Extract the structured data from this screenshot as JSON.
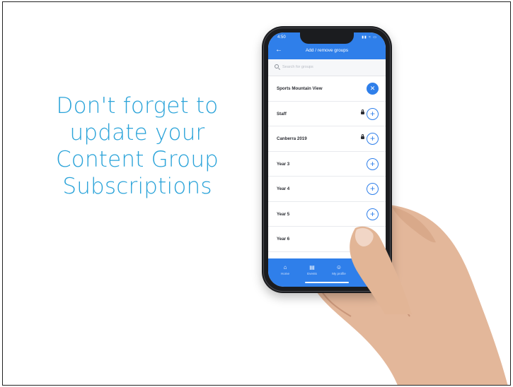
{
  "headline": {
    "lines": [
      "Don't forget to",
      "update your",
      "Content Group",
      "Subscriptions"
    ]
  },
  "colors": {
    "headline": "#2aa3d9",
    "app_primary": "#2f7fea"
  },
  "phone": {
    "status_time": "4:50",
    "status_icons": "signal wifi battery",
    "header": {
      "back_icon": "back-arrow-icon",
      "title": "Add / remove groups"
    },
    "search": {
      "placeholder": "Search for groups",
      "value": ""
    },
    "groups": [
      {
        "name": "Sports Mountain View",
        "locked": false,
        "action": "remove"
      },
      {
        "name": "Staff",
        "locked": true,
        "action": "add"
      },
      {
        "name": "Canberra 2019",
        "locked": true,
        "action": "add"
      },
      {
        "name": "Year 3",
        "locked": false,
        "action": "add"
      },
      {
        "name": "Year 4",
        "locked": false,
        "action": "add"
      },
      {
        "name": "Year 5",
        "locked": false,
        "action": "add"
      },
      {
        "name": "Year 6",
        "locked": false,
        "action": "add"
      }
    ],
    "tabs": [
      {
        "label": "Home",
        "icon": "home-icon"
      },
      {
        "label": "Events",
        "icon": "calendar-icon"
      },
      {
        "label": "My profile",
        "icon": "person-icon"
      }
    ]
  }
}
